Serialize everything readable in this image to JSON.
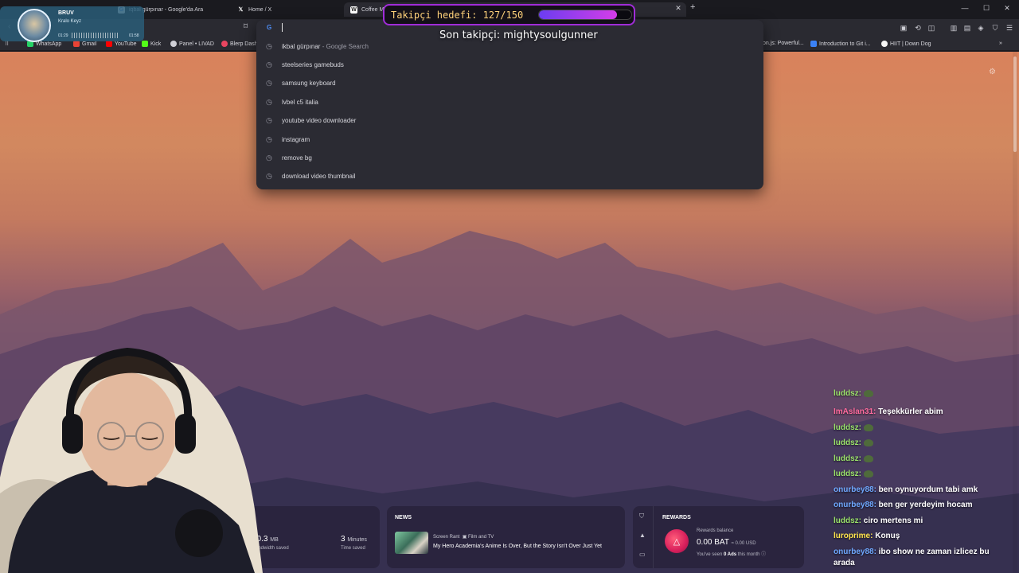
{
  "tabs": [
    {
      "title": "BRUV",
      "icon": "music-note-icon",
      "active": false
    },
    {
      "title": "iqbal gürpınar - Google'da Ara",
      "icon": "google-icon",
      "active": false
    },
    {
      "title": "Home / X",
      "icon": "x-icon",
      "active": false
    },
    {
      "title": "Coffee M",
      "icon": "w-icon",
      "active": true
    }
  ],
  "window_controls": {
    "minimize": "—",
    "maximize": "☐",
    "close": "✕"
  },
  "new_tab": "+",
  "omnibox": {
    "engine_icon": "G",
    "value": "",
    "suggestions": [
      {
        "text": "ikbal gürpınar",
        "suffix": " - Google Search"
      },
      {
        "text": "steelseries gamebuds",
        "suffix": ""
      },
      {
        "text": "samsung keyboard",
        "suffix": ""
      },
      {
        "text": "lvbel c5 italia",
        "suffix": ""
      },
      {
        "text": "youtube video downloader",
        "suffix": ""
      },
      {
        "text": "instagram",
        "suffix": ""
      },
      {
        "text": "remove bg",
        "suffix": ""
      },
      {
        "text": "download video thumbnail",
        "suffix": ""
      }
    ]
  },
  "bookmarks": [
    {
      "label": "WhatsApp",
      "color": "#25d366"
    },
    {
      "label": "Gmail",
      "color": "#ea4335"
    },
    {
      "label": "YouTube",
      "color": "#ff0000"
    },
    {
      "label": "Kick",
      "color": "#53fc18"
    },
    {
      "label": "Panel • LIVAD",
      "color": "#cfcfd6"
    },
    {
      "label": "Blerp Dash",
      "color": "#e94560"
    },
    {
      "label": "on.js: Powerful...",
      "color": "#f0c040"
    },
    {
      "label": "Introduction to Git i...",
      "color": "#3b82f6"
    },
    {
      "label": "HIIT | Down Dog",
      "color": "#f5f5f5"
    }
  ],
  "overlay": {
    "follower_goal_text": "Takipçi hedefi: 127/150",
    "follower_current": 127,
    "follower_goal": 150,
    "last_follower_text": "Son takipçi: mightysoulgunner"
  },
  "music": {
    "title": "BRUV",
    "artist": "Kralo Keyz",
    "elapsed": "01:29",
    "duration": "01:58"
  },
  "widgets": {
    "stats": {
      "bandwidth_value": "20.3",
      "bandwidth_unit": "MB",
      "bandwidth_label": "Bandwidth saved",
      "time_value": "3",
      "time_unit": "Minutes",
      "time_label": "Time saved"
    },
    "news": {
      "label": "NEWS",
      "source": "Screen Rant",
      "category": "Film and TV",
      "headline": "My Hero Academia's Anime Is Over, But the Story Isn't Over Just Yet"
    },
    "rewards": {
      "label": "REWARDS",
      "balance_label": "Rewards balance",
      "balance": "0.00 BAT",
      "balance_usd": "≈ 0.00 USD",
      "seen_prefix": "You've seen",
      "seen_value": "0 Ads",
      "seen_suffix": "this month"
    }
  },
  "chat": [
    {
      "user": "luddsz:",
      "color": "#9be36a",
      "text": "",
      "emote": true
    },
    {
      "user": "ImAslan31:",
      "color": "#ff6b9e",
      "text": "Teşekkürler abim",
      "emote": false
    },
    {
      "user": "luddsz:",
      "color": "#9be36a",
      "text": "",
      "emote": true
    },
    {
      "user": "luddsz:",
      "color": "#9be36a",
      "text": "",
      "emote": true
    },
    {
      "user": "luddsz:",
      "color": "#9be36a",
      "text": "",
      "emote": true
    },
    {
      "user": "luddsz:",
      "color": "#9be36a",
      "text": "",
      "emote": true
    },
    {
      "user": "onurbey88:",
      "color": "#6fa8ff",
      "text": "ben oynuyordum tabi amk",
      "emote": false
    },
    {
      "user": "onurbey88:",
      "color": "#6fa8ff",
      "text": "ben ger yerdeyim hocam",
      "emote": false
    },
    {
      "user": "luddsz:",
      "color": "#9be36a",
      "text": "ciro mertens mi",
      "emote": false
    },
    {
      "user": "luroprime:",
      "color": "#ffe44d",
      "text": "Konuş",
      "emote": false
    },
    {
      "user": "onurbey88:",
      "color": "#6fa8ff",
      "text": "ibo show ne zaman izlicez bu arada",
      "emote": false
    }
  ]
}
